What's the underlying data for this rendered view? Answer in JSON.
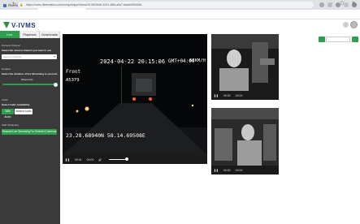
{
  "browser": {
    "tabs": [
      {
        "label": "Fleet Management",
        "active": false
      },
      {
        "label": "Videos",
        "active": true
      }
    ],
    "new_tab": "+",
    "url": "https://coms.fleetmatics.com/comp/#/app/videos/10-f5f19d4f-4241-4f8d-a0a7-6aabd3f0d461"
  },
  "app": {
    "logo_text": "V-IVMS",
    "brand_color": "#2e9e4f"
  },
  "left_panel": {
    "tabs": [
      "Live",
      "Playback",
      "Downloads"
    ],
    "active_tab": "Live",
    "camera_channel_label": "Camera Channel",
    "channel_help": "Select the camera channel you want to see",
    "channel_placeholder": "Select a channel",
    "duration_label": "Duration",
    "duration_help": "Select the duration of live Streaming in seconds",
    "duration_value": "60seconds",
    "duration_fraction": 1.0,
    "audio_label": "Audio",
    "audio_help": "Select Audio Availability",
    "with_audio": "With Audio",
    "without_audio": "Without Audio",
    "start_label": "Start Streaming",
    "request_button": "Request Live Streaming For Selected Cameras"
  },
  "main_player": {
    "osd_timestamp": "2024-04-22 20:15:06",
    "osd_tz": "GMT+04:00",
    "osd_speed": "66KM/H",
    "osd_channel": "Front",
    "osd_id": "A5379",
    "osd_coords": "23.28.68940N 58.14.69508E",
    "time_current": "00:01",
    "time_total": "00:00",
    "volume_fraction": 1.0
  },
  "side_players": [
    {
      "time_current": "00:02",
      "time_total": "00:00"
    },
    {
      "time_current": "00:02",
      "time_total": "00:00"
    }
  ]
}
